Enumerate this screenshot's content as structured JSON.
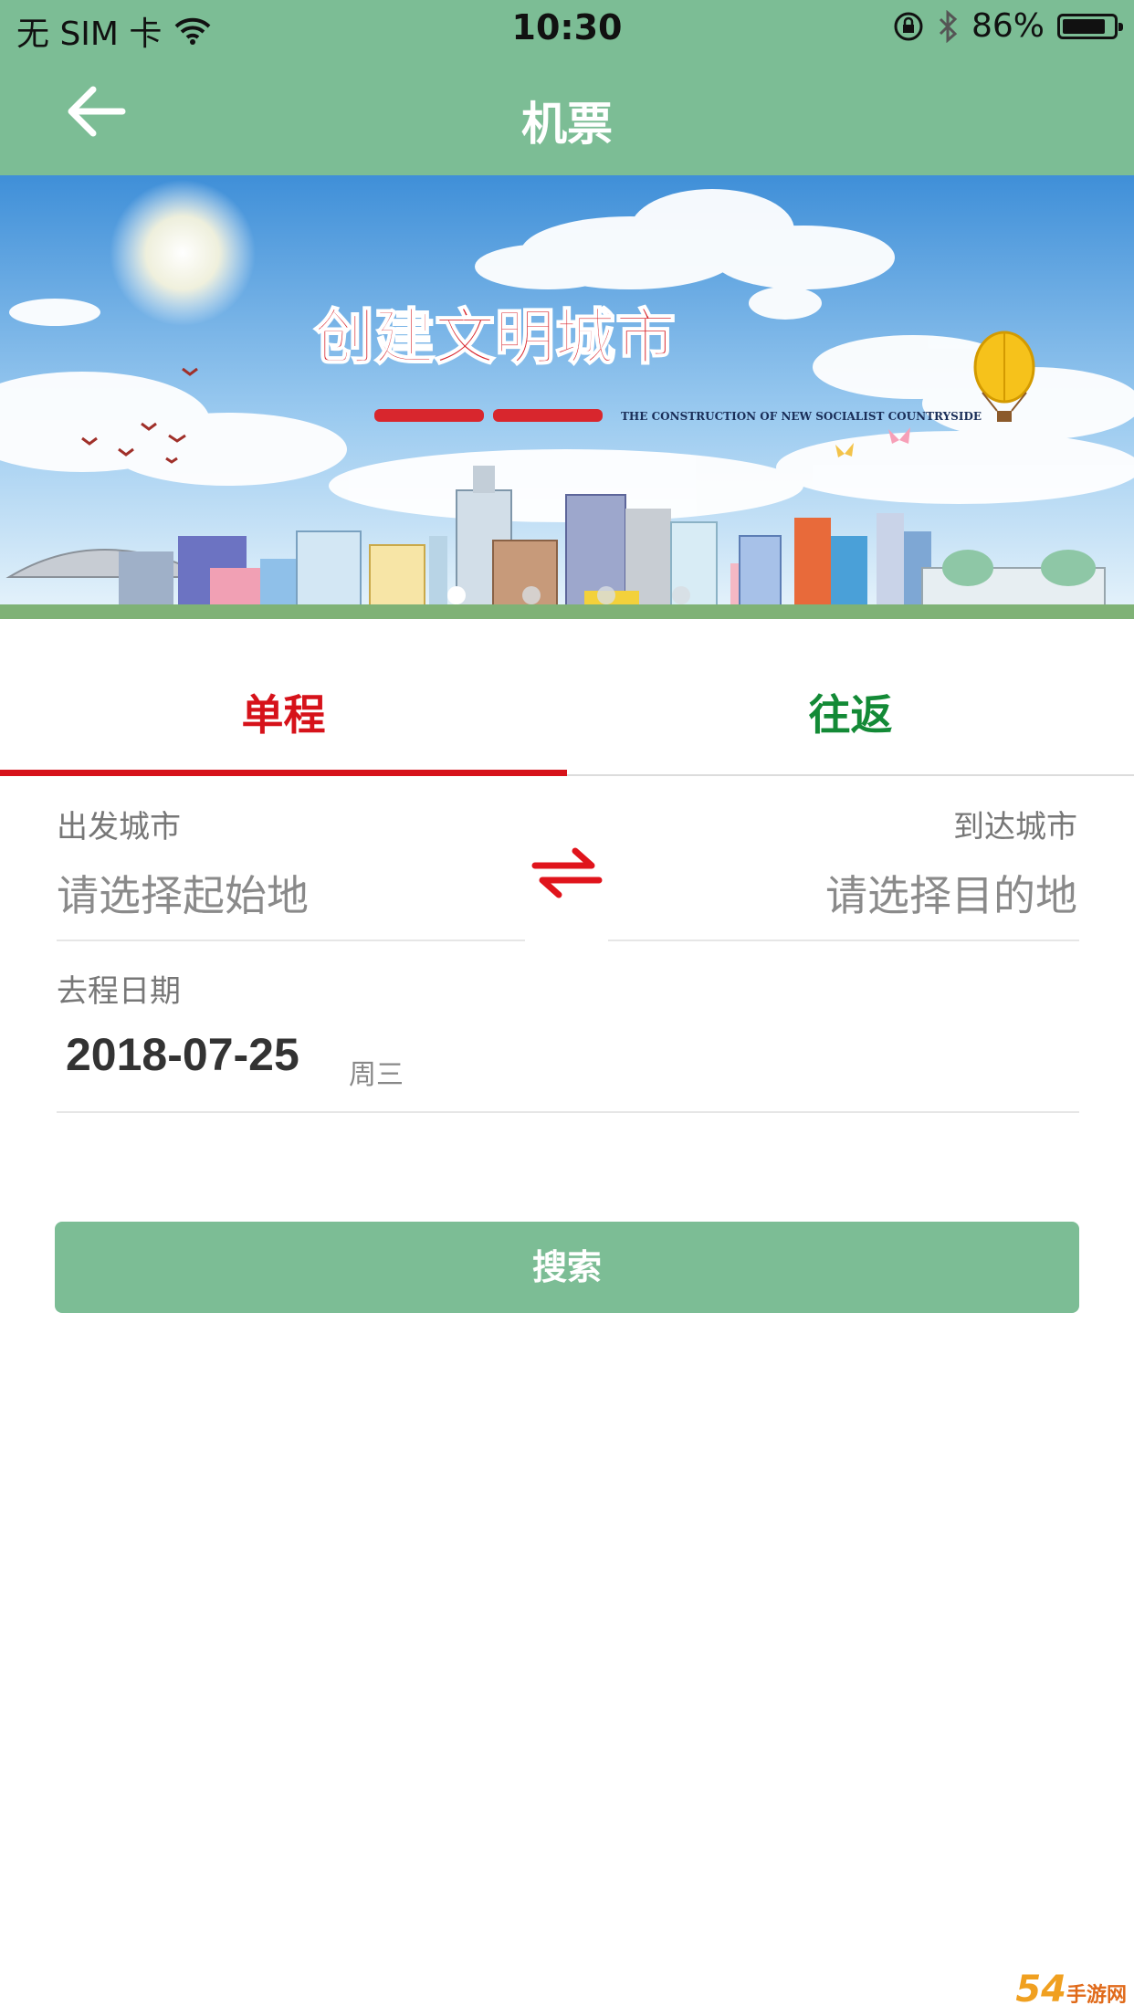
{
  "status_bar": {
    "carrier": "无 SIM 卡",
    "time": "10:30",
    "battery_percent": "86%",
    "battery_level": 0.86
  },
  "nav": {
    "title": "机票",
    "back_icon": "arrow-left-icon"
  },
  "banner": {
    "headline": "创建文明城市",
    "subline_en": "THE CONSTRUCTION OF NEW SOCIALIST COUNTRYSIDE",
    "page_count": 4,
    "active_page": 0
  },
  "tabs": [
    {
      "label": "单程",
      "active": true
    },
    {
      "label": "往返",
      "active": false
    }
  ],
  "form": {
    "from_label": "出发城市",
    "from_placeholder": "请选择起始地",
    "to_label": "到达城市",
    "to_placeholder": "请选择目的地",
    "swap_icon": "swap-arrows-icon",
    "date_label": "去程日期",
    "date_value": "2018-07-25",
    "weekday": "周三"
  },
  "search_button": "搜索",
  "watermark": {
    "main": "54",
    "sub": "手游网"
  },
  "colors": {
    "header_green": "#7cbd95",
    "tab_active_red": "#d6121a",
    "tab_inactive_green": "#138a36"
  }
}
